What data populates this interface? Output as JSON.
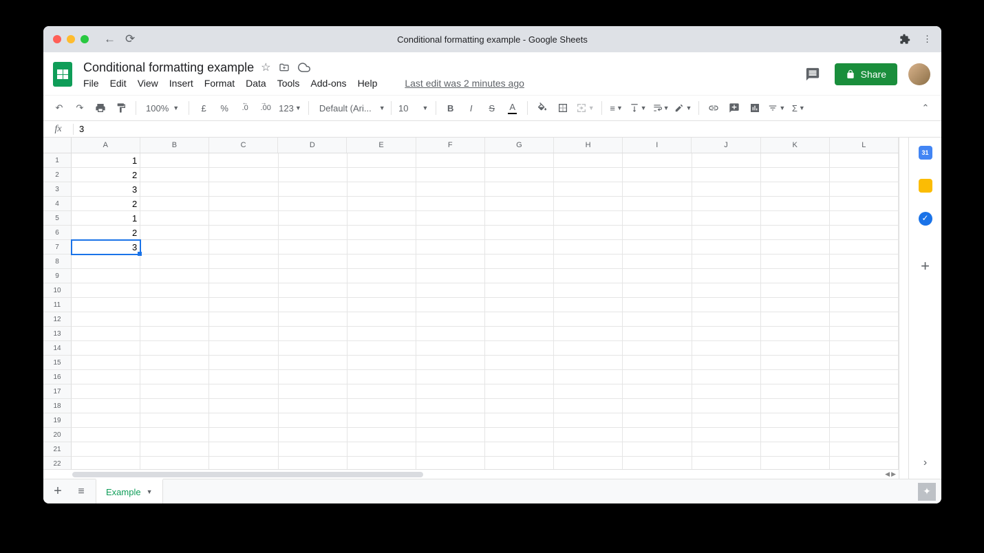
{
  "browser": {
    "title": "Conditional formatting example - Google Sheets"
  },
  "doc": {
    "title": "Conditional formatting example",
    "last_edit": "Last edit was 2 minutes ago"
  },
  "menus": [
    "File",
    "Edit",
    "View",
    "Insert",
    "Format",
    "Data",
    "Tools",
    "Add-ons",
    "Help"
  ],
  "toolbar": {
    "zoom": "100%",
    "currency": "£",
    "percent": "%",
    "dec_dec": ".0",
    "dec_inc": ".00",
    "num_fmt": "123",
    "font": "Default (Ari...",
    "font_size": "10"
  },
  "share": {
    "label": "Share"
  },
  "formula": {
    "fx": "fx",
    "value": "3"
  },
  "columns": [
    "A",
    "B",
    "C",
    "D",
    "E",
    "F",
    "G",
    "H",
    "I",
    "J",
    "K",
    "L"
  ],
  "row_count": 22,
  "cell_values": {
    "1": "1",
    "2": "2",
    "3": "3",
    "4": "2",
    "5": "1",
    "6": "2",
    "7": "3"
  },
  "selected_row": 7,
  "sheet_tab": "Example"
}
